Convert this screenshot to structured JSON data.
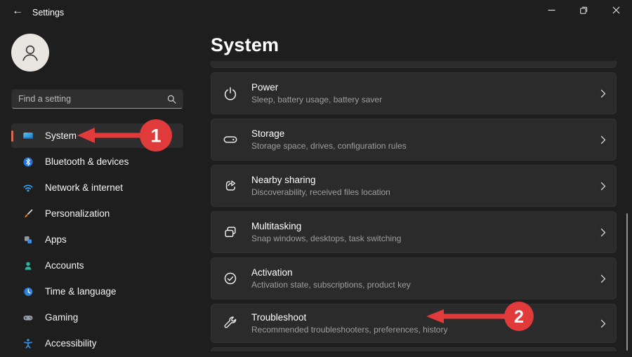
{
  "titlebar": {
    "title": "Settings",
    "back_icon": "arrow-left",
    "controls": {
      "minimize": "minimize",
      "restore": "restore",
      "close": "close"
    }
  },
  "sidebar": {
    "search": {
      "placeholder": "Find a setting",
      "icon": "search-icon"
    },
    "items": [
      {
        "label": "System",
        "icon": "system-icon",
        "selected": true
      },
      {
        "label": "Bluetooth & devices",
        "icon": "bluetooth-icon",
        "selected": false
      },
      {
        "label": "Network & internet",
        "icon": "network-icon",
        "selected": false
      },
      {
        "label": "Personalization",
        "icon": "personalization-icon",
        "selected": false
      },
      {
        "label": "Apps",
        "icon": "apps-icon",
        "selected": false
      },
      {
        "label": "Accounts",
        "icon": "accounts-icon",
        "selected": false
      },
      {
        "label": "Time & language",
        "icon": "time-language-icon",
        "selected": false
      },
      {
        "label": "Gaming",
        "icon": "gaming-icon",
        "selected": false
      },
      {
        "label": "Accessibility",
        "icon": "accessibility-icon",
        "selected": false
      }
    ]
  },
  "content": {
    "title": "System",
    "rows": [
      {
        "title": "Power",
        "subtitle": "Sleep, battery usage, battery saver",
        "icon": "power-icon"
      },
      {
        "title": "Storage",
        "subtitle": "Storage space, drives, configuration rules",
        "icon": "storage-icon"
      },
      {
        "title": "Nearby sharing",
        "subtitle": "Discoverability, received files location",
        "icon": "nearby-sharing-icon"
      },
      {
        "title": "Multitasking",
        "subtitle": "Snap windows, desktops, task switching",
        "icon": "multitasking-icon"
      },
      {
        "title": "Activation",
        "subtitle": "Activation state, subscriptions, product key",
        "icon": "activation-icon"
      },
      {
        "title": "Troubleshoot",
        "subtitle": "Recommended troubleshooters, preferences, history",
        "icon": "troubleshoot-icon"
      }
    ]
  },
  "annotations": [
    {
      "number": "1",
      "target": "System sidebar item"
    },
    {
      "number": "2",
      "target": "Troubleshoot row"
    }
  ],
  "colors": {
    "annotation_red": "#e03a3a",
    "accent_pill": "#d96a56",
    "card_background": "#2b2b2b",
    "window_background": "#1e1e1e"
  }
}
